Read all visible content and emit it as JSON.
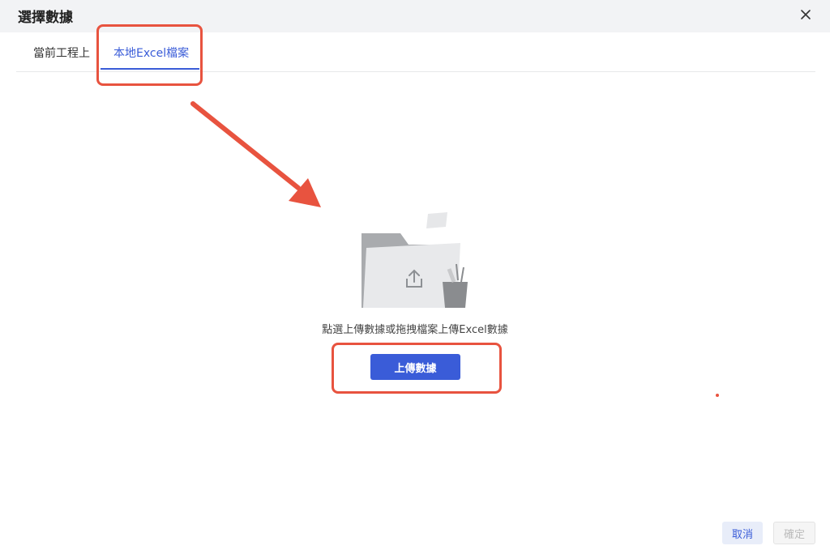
{
  "dialog": {
    "title": "選擇數據",
    "close_icon": "close-icon"
  },
  "tabs": [
    {
      "label": "當前工程上",
      "active": false
    },
    {
      "label": "本地Excel檔案",
      "active": true
    }
  ],
  "upload_area": {
    "icon": "folder-upload-icon",
    "hint": "點選上傳數據或拖拽檔案上傳Excel數據",
    "button_label": "上傳數據"
  },
  "footer": {
    "cancel_label": "取消",
    "confirm_label": "確定",
    "confirm_disabled": true
  },
  "colors": {
    "accent": "#3a5cd8",
    "annotation": "#e8533f",
    "header_bg": "#f2f3f5"
  }
}
